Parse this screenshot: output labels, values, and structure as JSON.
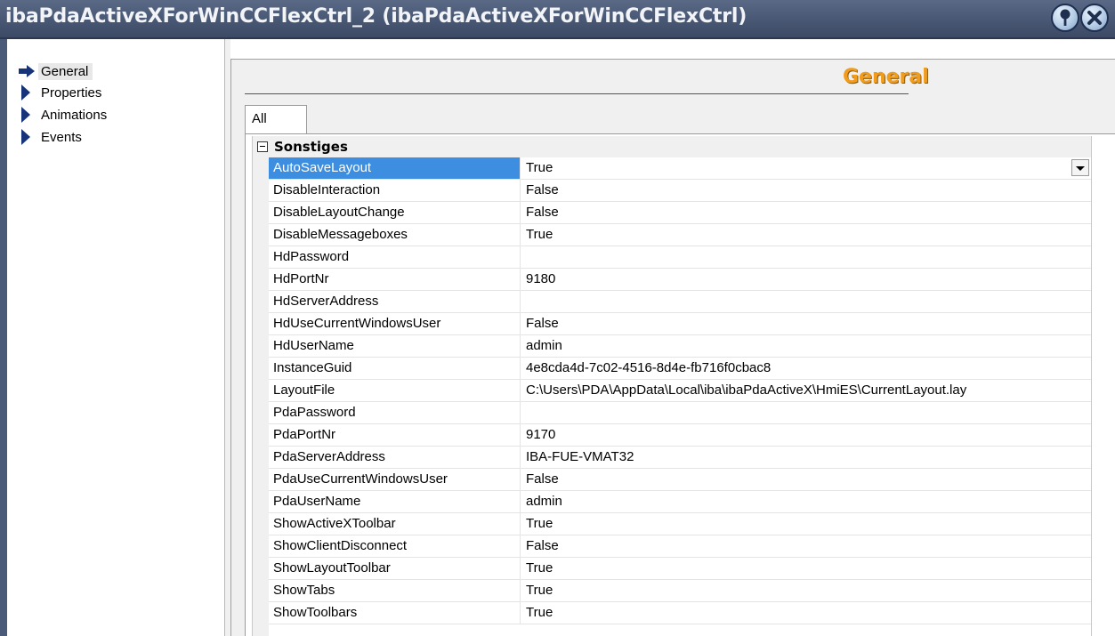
{
  "window": {
    "title": "ibaPdaActiveXForWinCCFlexCtrl_2 (ibaPdaActiveXForWinCCFlexCtrl)",
    "help_icon": "pushpin-help-icon",
    "close_icon": "close-icon"
  },
  "nav": {
    "items": [
      {
        "label": "General",
        "icon": "arrow-right-icon",
        "active": true
      },
      {
        "label": "Properties",
        "icon": "triangle-right-icon"
      },
      {
        "label": "Animations",
        "icon": "triangle-right-icon"
      },
      {
        "label": "Events",
        "icon": "triangle-right-icon"
      }
    ]
  },
  "main": {
    "heading": "General",
    "tab": "All"
  },
  "grid": {
    "category": "Sonstiges",
    "selected": "AutoSaveLayout",
    "properties": [
      {
        "name": "AutoSaveLayout",
        "value": "True"
      },
      {
        "name": "DisableInteraction",
        "value": "False"
      },
      {
        "name": "DisableLayoutChange",
        "value": "False"
      },
      {
        "name": "DisableMessageboxes",
        "value": "True"
      },
      {
        "name": "HdPassword",
        "value": ""
      },
      {
        "name": "HdPortNr",
        "value": "9180"
      },
      {
        "name": "HdServerAddress",
        "value": ""
      },
      {
        "name": "HdUseCurrentWindowsUser",
        "value": "False"
      },
      {
        "name": "HdUserName",
        "value": "admin"
      },
      {
        "name": "InstanceGuid",
        "value": "4e8cda4d-7c02-4516-8d4e-fb716f0cbac8"
      },
      {
        "name": "LayoutFile",
        "value": "C:\\Users\\PDA\\AppData\\Local\\iba\\ibaPdaActiveX\\HmiES\\CurrentLayout.lay"
      },
      {
        "name": "PdaPassword",
        "value": ""
      },
      {
        "name": "PdaPortNr",
        "value": "9170"
      },
      {
        "name": "PdaServerAddress",
        "value": "IBA-FUE-VMAT32"
      },
      {
        "name": "PdaUseCurrentWindowsUser",
        "value": "False"
      },
      {
        "name": "PdaUserName",
        "value": "admin"
      },
      {
        "name": "ShowActiveXToolbar",
        "value": "True"
      },
      {
        "name": "ShowClientDisconnect",
        "value": "False"
      },
      {
        "name": "ShowLayoutToolbar",
        "value": "True"
      },
      {
        "name": "ShowTabs",
        "value": "True"
      },
      {
        "name": "ShowToolbars",
        "value": "True"
      }
    ]
  }
}
